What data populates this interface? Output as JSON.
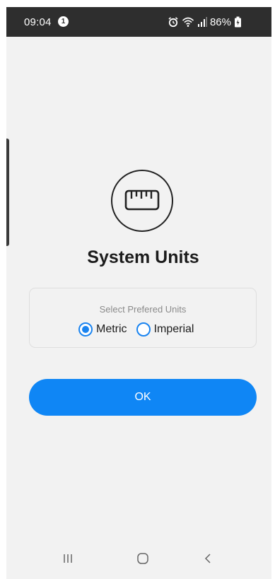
{
  "status_bar": {
    "time": "09:04",
    "notification_count": "1",
    "battery_percent": "86%",
    "icons": [
      "alarm-icon",
      "wifi-icon",
      "signal-icon",
      "battery-icon"
    ]
  },
  "main": {
    "icon": "ruler-icon",
    "title": "System Units",
    "units_card": {
      "caption": "Select Prefered Units",
      "options": [
        {
          "label": "Metric",
          "selected": true
        },
        {
          "label": "Imperial",
          "selected": false
        }
      ]
    },
    "ok_label": "OK"
  },
  "nav_bar": {
    "buttons": [
      "recent-apps-icon",
      "home-icon",
      "back-icon"
    ]
  },
  "colors": {
    "accent": "#0f86f5",
    "radio": "#1a84f0",
    "background": "#f2f2f2",
    "status_bar": "#2e2e2e",
    "title": "#1c1c1c",
    "caption": "#8a8a8a"
  }
}
